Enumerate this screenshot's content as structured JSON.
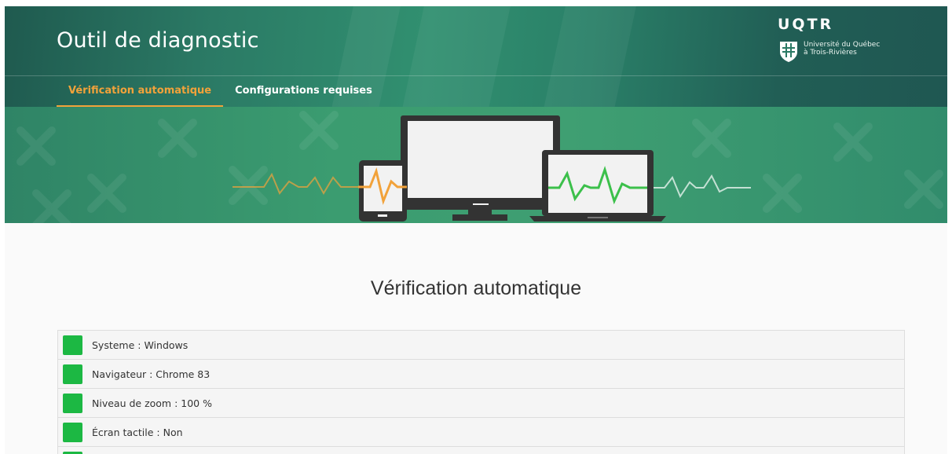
{
  "app": {
    "title": "Outil de diagnostic",
    "logo": {
      "wordmark": "UQTR",
      "line1": "Université du Québec",
      "line2": "à Trois-Rivières"
    }
  },
  "tabs": [
    {
      "label": "Vérification automatique",
      "active": true
    },
    {
      "label": "Configurations requises",
      "active": false
    }
  ],
  "main": {
    "heading": "Vérification automatique",
    "checks": [
      {
        "label": "Systeme : Windows",
        "status": "ok"
      },
      {
        "label": "Navigateur : Chrome 83",
        "status": "ok"
      },
      {
        "label": "Niveau de zoom : 100 %",
        "status": "ok"
      },
      {
        "label": "Écran tactile : Non",
        "status": "ok"
      },
      {
        "label": "",
        "status": "ok"
      }
    ]
  },
  "colors": {
    "accent": "#f2a23a",
    "status_ok": "#1cb843",
    "header_green": "#2b7a65"
  },
  "icons": [
    "uqtr-shield-icon",
    "devices-illustration",
    "status-ok-icon"
  ]
}
